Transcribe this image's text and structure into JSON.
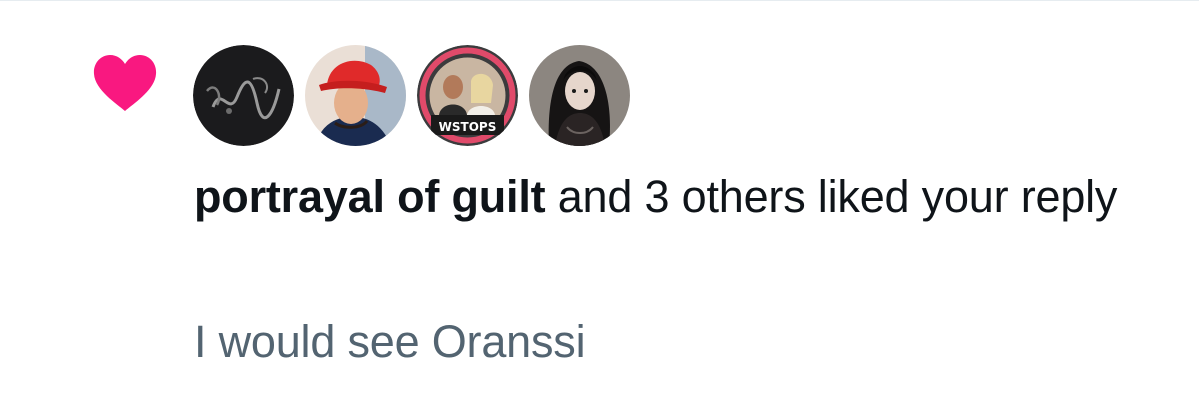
{
  "notification": {
    "actor_name": "portrayal of guilt",
    "action_text": " and 3 others liked your reply",
    "reply_preview": "I would see Oranssi",
    "icon": "heart-icon",
    "avatars": [
      {
        "name": "avatar-1",
        "style": "dark-abstract"
      },
      {
        "name": "avatar-2",
        "style": "red-cap-person"
      },
      {
        "name": "avatar-3",
        "style": "wrestling-duo"
      },
      {
        "name": "avatar-4",
        "style": "goth-portrait"
      }
    ]
  },
  "colors": {
    "heart": "#f91880",
    "primary_text": "#0f1419",
    "secondary_text": "#536471",
    "divider": "#e6ecf0"
  }
}
